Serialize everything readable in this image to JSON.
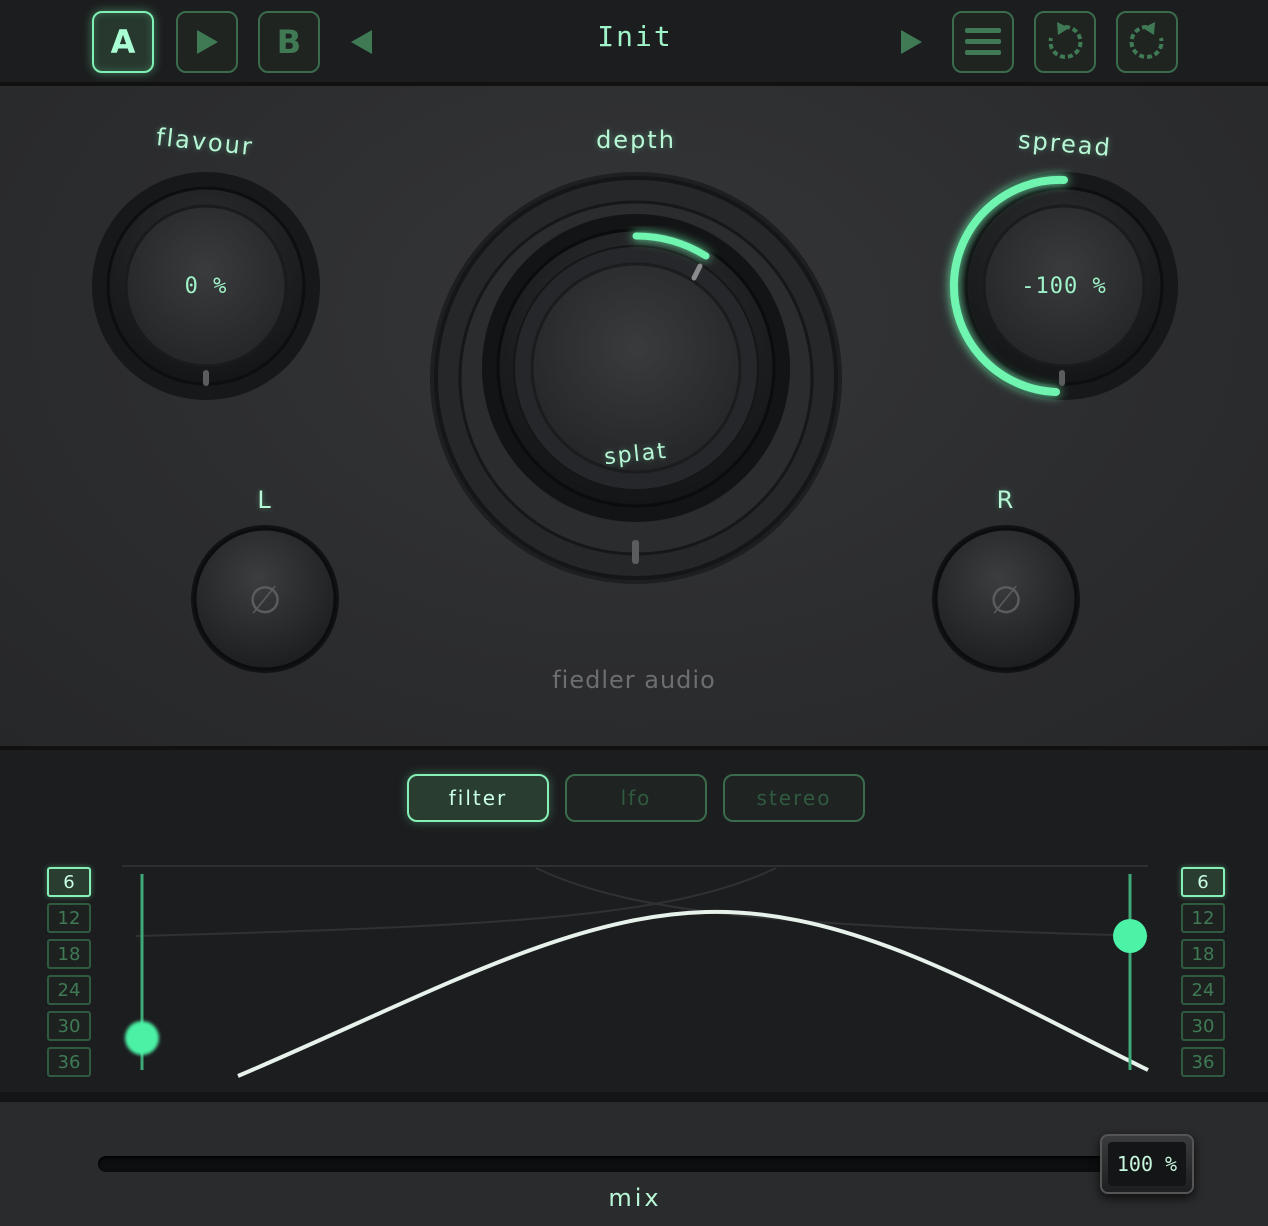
{
  "topbar": {
    "slot_a": "A",
    "slot_b": "B",
    "preset_name": "Init",
    "icons": [
      "play-icon",
      "prev-arrow-icon",
      "next-arrow-icon",
      "menu-icon",
      "undo-icon",
      "redo-icon"
    ]
  },
  "knobs": {
    "flavour": {
      "label": "flavour",
      "value": "0 %"
    },
    "depth": {
      "label": "depth",
      "mode": "splat"
    },
    "spread": {
      "label": "spread",
      "value": "-100 %"
    },
    "left": {
      "label": "L",
      "symbol": "∅"
    },
    "right": {
      "label": "R",
      "symbol": "∅"
    }
  },
  "brand": "fiedler audio",
  "tabs": [
    "filter",
    "lfo",
    "stereo"
  ],
  "active_tab": "filter",
  "filter": {
    "slopes": [
      "6",
      "12",
      "18",
      "24",
      "30",
      "36"
    ],
    "left_active_slope": "6",
    "right_active_slope": "6"
  },
  "mix": {
    "label": "mix",
    "value": "100 %"
  },
  "colors": {
    "accent": "#5ff0a6",
    "accent_text": "#9ff3c9",
    "background": "#2a2b2d"
  }
}
